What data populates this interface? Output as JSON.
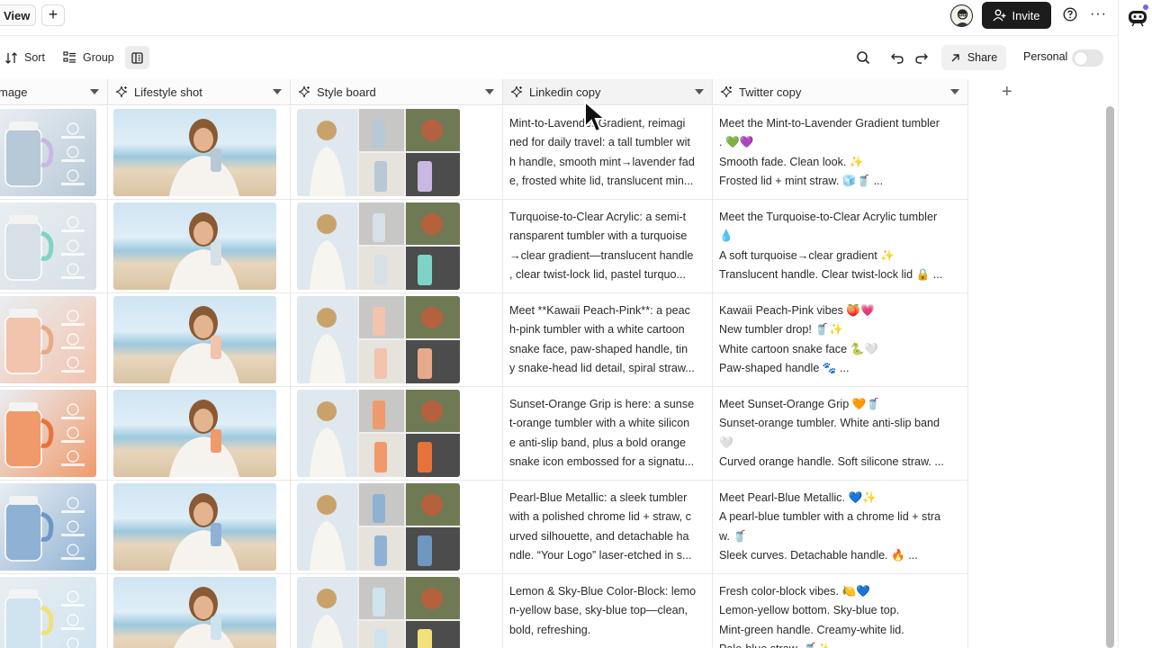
{
  "topbar": {
    "view_tab": "View",
    "add_tab": "+",
    "invite_label": "Invite",
    "more": "···"
  },
  "toolbar": {
    "sort_label": "Sort",
    "group_label": "Group",
    "share_label": "Share",
    "personal_label": "Personal",
    "personal_toggle_on": false
  },
  "columns": [
    {
      "label": "mage",
      "icon": "image-icon"
    },
    {
      "label": "Lifestyle shot",
      "icon": "sparkle-icon"
    },
    {
      "label": "Style board",
      "icon": "sparkle-icon"
    },
    {
      "label": "Linkedin copy",
      "icon": "sparkle-icon"
    },
    {
      "label": "Twitter copy",
      "icon": "sparkle-icon"
    }
  ],
  "add_column": "+",
  "rows": [
    {
      "product_color": "#b7c8d6",
      "accent": "#c8b8e2",
      "linkedin": [
        "Mint-to-Lavender Gradient, reimagi",
        "ned for daily travel: a tall tumbler wit",
        "h handle, smooth mint→lavender fad",
        "e, frosted white lid, translucent min..."
      ],
      "twitter": [
        "Meet the Mint-to-Lavender Gradient tumbler",
        ". 💚💜",
        "Smooth fade. Clean look. ✨",
        "Frosted lid + mint straw. 🧊🥤   ..."
      ]
    },
    {
      "product_color": "#d6e0e6",
      "accent": "#7fd3c6",
      "linkedin": [
        "Turquoise-to-Clear Acrylic: a semi-t",
        "ransparent tumbler with a turquoise",
        "→clear gradient—translucent handle",
        ", clear twist-lock lid, pastel turquo..."
      ],
      "twitter": [
        "Meet the Turquoise-to-Clear Acrylic tumbler",
        "💧",
        "A soft turquoise→clear gradient ✨",
        "Translucent handle. Clear twist-lock lid 🔒  ..."
      ]
    },
    {
      "product_color": "#f2c3ad",
      "accent": "#e8a98a",
      "linkedin": [
        "Meet **Kawaii Peach-Pink**: a peac",
        "h-pink tumbler with a white cartoon",
        "snake face, paw-shaped handle, tin",
        "y snake-head lid detail, spiral straw..."
      ],
      "twitter": [
        "Kawaii Peach-Pink vibes 🍑💗",
        "New tumbler drop! 🥤✨",
        "White cartoon snake face 🐍🤍",
        "Paw-shaped handle 🐾   ..."
      ]
    },
    {
      "product_color": "#f09a6b",
      "accent": "#e8733a",
      "linkedin": [
        "Sunset-Orange Grip is here: a sunse",
        "t-orange tumbler with a white silicon",
        "e anti-slip band, plus a bold orange",
        "snake icon embossed for a signatu..."
      ],
      "twitter": [
        "Meet Sunset-Orange Grip 🧡🥤",
        "Sunset-orange tumbler. White anti-slip band",
        "🤍",
        "Curved orange handle. Soft silicone straw.  ..."
      ]
    },
    {
      "product_color": "#8fb2d4",
      "accent": "#6e97c2",
      "linkedin": [
        "Pearl-Blue Metallic: a sleek tumbler",
        "with a polished chrome lid + straw, c",
        "urved silhouette, and detachable ha",
        "ndle. “Your Logo” laser-etched in s..."
      ],
      "twitter": [
        "Meet Pearl-Blue Metallic. 💙✨",
        "A pearl-blue tumbler with a chrome lid + stra",
        "w. 🥤",
        "Sleek curves. Detachable handle. 🔥  ..."
      ]
    },
    {
      "product_color": "#cfe3ef",
      "accent": "#f2e07a",
      "linkedin": [
        "Lemon & Sky-Blue Color-Block: lemo",
        "n-yellow base, sky-blue top—clean,",
        "bold, refreshing.",
        ""
      ],
      "twitter": [
        "Fresh color-block vibes. 🍋💙",
        "Lemon-yellow bottom. Sky-blue top.",
        "Mint-green handle. Creamy-white lid.",
        "Pale-blue straw. 🥤✨"
      ]
    }
  ]
}
